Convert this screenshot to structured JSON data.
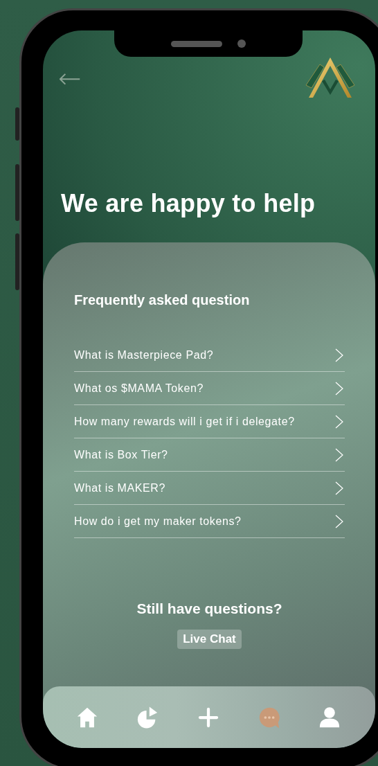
{
  "header": {
    "back": "←"
  },
  "title": "We are happy to help",
  "faq": {
    "heading": "Frequently asked question",
    "items": [
      {
        "question": "What is Masterpiece Pad?"
      },
      {
        "question": "What os $MAMA Token?"
      },
      {
        "question": "How many rewards will i get if i delegate?"
      },
      {
        "question": "What is Box Tier?"
      },
      {
        "question": "What is MAKER?"
      },
      {
        "question": "How do i get my maker tokens?"
      }
    ]
  },
  "support": {
    "prompt": "Still have questions?",
    "button": "Live Chat"
  },
  "nav": [
    {
      "kind": "home",
      "selected": false
    },
    {
      "kind": "chart",
      "selected": false
    },
    {
      "kind": "add",
      "selected": false
    },
    {
      "kind": "chat",
      "selected": true
    },
    {
      "kind": "profile",
      "selected": false
    }
  ]
}
